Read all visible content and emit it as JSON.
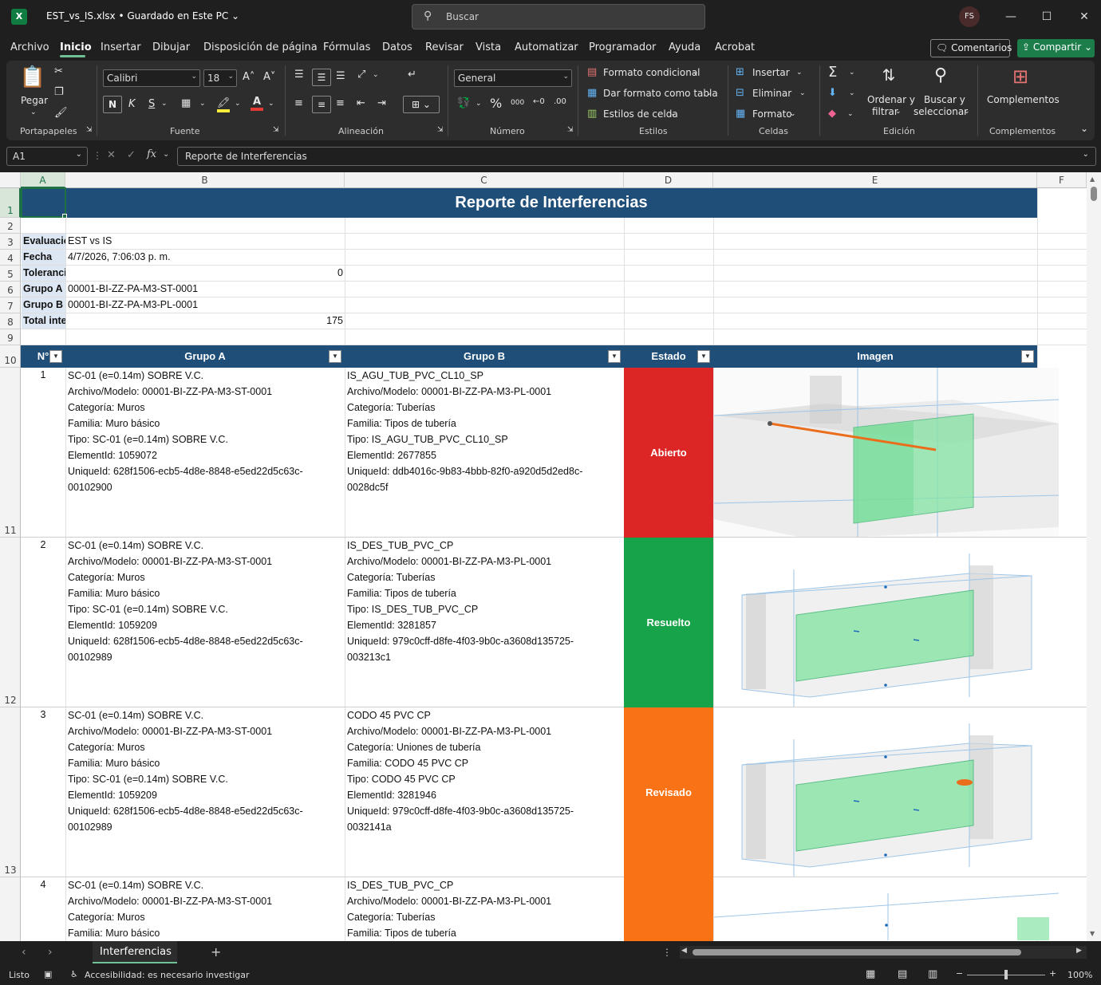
{
  "window": {
    "title": "EST_vs_IS.xlsx • Guardado en Este PC ⌄",
    "search_placeholder": "Buscar",
    "avatar": "FS"
  },
  "menu": {
    "items": [
      "Archivo",
      "Inicio",
      "Insertar",
      "Dibujar",
      "Disposición de página",
      "Fórmulas",
      "Datos",
      "Revisar",
      "Vista",
      "Automatizar",
      "Programador",
      "Ayuda",
      "Acrobat"
    ],
    "comments_label": "Comentarios",
    "share_label": "Compartir"
  },
  "ribbon": {
    "groups": {
      "clipboard": "Portapapeles",
      "font": "Fuente",
      "alignment": "Alineación",
      "number": "Número",
      "styles": "Estilos",
      "cells": "Celdas",
      "editing": "Edición",
      "addins": "Complementos"
    },
    "paste_label": "Pegar",
    "font_name": "Calibri",
    "font_size": "18",
    "number_format": "General",
    "conditional_format": "Formato condicional",
    "format_as_table": "Dar formato como tabla",
    "cell_styles": "Estilos de celda",
    "insert": "Insertar",
    "delete": "Eliminar",
    "format": "Formato",
    "sort_filter_1": "Ordenar y",
    "sort_filter_2": "filtrar",
    "find_select_1": "Buscar y",
    "find_select_2": "seleccionar",
    "addins_btn": "Complementos",
    "bold": "N",
    "italic": "K",
    "underline": "S"
  },
  "formula_bar": {
    "name_box": "A1",
    "fx": "fx",
    "value": "Reporte de Interferencias"
  },
  "sheet": {
    "columns": [
      "A",
      "B",
      "C",
      "D",
      "E",
      "F"
    ],
    "title": "Reporte de Interferencias",
    "meta": [
      {
        "row": "3",
        "label": "Evaluación",
        "value": "EST vs IS",
        "align": "left"
      },
      {
        "row": "4",
        "label": "Fecha",
        "value": "4/7/2026, 7:06:03 p. m.",
        "align": "left"
      },
      {
        "row": "5",
        "label": "Tolerancia",
        "value": "0",
        "align": "right"
      },
      {
        "row": "6",
        "label": "Grupo A",
        "value": "00001-BI-ZZ-PA-M3-ST-0001",
        "align": "left"
      },
      {
        "row": "7",
        "label": "Grupo B",
        "value": "00001-BI-ZZ-PA-M3-PL-0001",
        "align": "left"
      },
      {
        "row": "8",
        "label": "Total interferencias",
        "value": "175",
        "align": "right"
      }
    ],
    "headers": [
      "N°",
      "Grupo A",
      "Grupo B",
      "Estado",
      "Imagen"
    ],
    "rows": [
      {
        "row": "11",
        "n": "1",
        "group_a": [
          "SC-01 (e=0.14m) SOBRE V.C.",
          "Archivo/Modelo: 00001-BI-ZZ-PA-M3-ST-0001",
          "Categoría: Muros",
          "Familia: Muro básico",
          "Tipo: SC-01 (e=0.14m) SOBRE V.C.",
          "ElementId: 1059072",
          "UniqueId: 628f1506-ecb5-4d8e-8848-e5ed22d5c63c-",
          "00102900"
        ],
        "group_b": [
          "IS_AGU_TUB_PVC_CL10_SP",
          "Archivo/Modelo: 00001-BI-ZZ-PA-M3-PL-0001",
          "Categoría: Tuberías",
          "Familia: Tipos de tubería",
          "Tipo: IS_AGU_TUB_PVC_CL10_SP",
          "ElementId: 2677855",
          "UniqueId: ddb4016c-9b83-4bbb-82f0-a920d5d2ed8c-",
          "0028dc5f"
        ],
        "status": "Abierto",
        "status_color": "#dc2626"
      },
      {
        "row": "12",
        "n": "2",
        "group_a": [
          "SC-01 (e=0.14m) SOBRE V.C.",
          "Archivo/Modelo: 00001-BI-ZZ-PA-M3-ST-0001",
          "Categoría: Muros",
          "Familia: Muro básico",
          "Tipo: SC-01 (e=0.14m) SOBRE V.C.",
          "ElementId: 1059209",
          "UniqueId: 628f1506-ecb5-4d8e-8848-e5ed22d5c63c-",
          "00102989"
        ],
        "group_b": [
          "IS_DES_TUB_PVC_CP",
          "Archivo/Modelo: 00001-BI-ZZ-PA-M3-PL-0001",
          "Categoría: Tuberías",
          "Familia: Tipos de tubería",
          "Tipo: IS_DES_TUB_PVC_CP",
          "ElementId: 3281857",
          "UniqueId: 979c0cff-d8fe-4f03-9b0c-a3608d135725-",
          "003213c1"
        ],
        "status": "Resuelto",
        "status_color": "#16a34a"
      },
      {
        "row": "13",
        "n": "3",
        "group_a": [
          "SC-01 (e=0.14m) SOBRE V.C.",
          "Archivo/Modelo: 00001-BI-ZZ-PA-M3-ST-0001",
          "Categoría: Muros",
          "Familia: Muro básico",
          "Tipo: SC-01 (e=0.14m) SOBRE V.C.",
          "ElementId: 1059209",
          "UniqueId: 628f1506-ecb5-4d8e-8848-e5ed22d5c63c-",
          "00102989"
        ],
        "group_b": [
          "CODO 45 PVC CP",
          "Archivo/Modelo: 00001-BI-ZZ-PA-M3-PL-0001",
          "Categoría: Uniones de tubería",
          "Familia: CODO 45 PVC CP",
          "Tipo: CODO 45 PVC CP",
          "ElementId: 3281946",
          "UniqueId: 979c0cff-d8fe-4f03-9b0c-a3608d135725-",
          "0032141a"
        ],
        "status": "Revisado",
        "status_color": "#f97316"
      },
      {
        "row": "",
        "n": "4",
        "group_a": [
          "SC-01 (e=0.14m) SOBRE V.C.",
          "Archivo/Modelo: 00001-BI-ZZ-PA-M3-ST-0001",
          "Categoría: Muros",
          "Familia: Muro básico"
        ],
        "group_b": [
          "IS_DES_TUB_PVC_CP",
          "Archivo/Modelo: 00001-BI-ZZ-PA-M3-PL-0001",
          "Categoría: Tuberías",
          "Familia: Tipos de tubería"
        ],
        "status": "",
        "status_color": "#f97316"
      }
    ],
    "tab_name": "Interferencias"
  },
  "statusbar": {
    "ready": "Listo",
    "accessibility": "Accesibilidad: es necesario investigar",
    "zoom": "100%"
  },
  "colors": {
    "header_blue": "#1f4e79",
    "label_bg": "#dde7f3",
    "excel_green": "#107c41"
  }
}
